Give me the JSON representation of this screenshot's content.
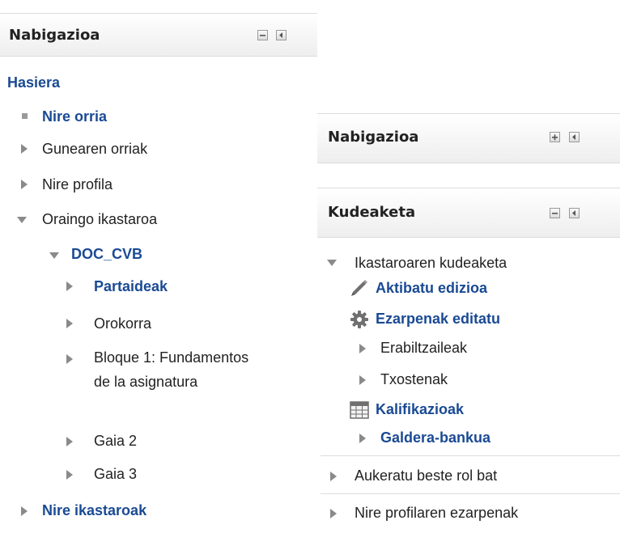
{
  "left_block": {
    "title": "Nabigazioa",
    "items": [
      {
        "label": "Hasiera"
      },
      {
        "label": "Nire orria"
      },
      {
        "label": "Gunearen orriak"
      },
      {
        "label": "Nire profila"
      },
      {
        "label": "Oraingo ikastaroa"
      },
      {
        "label": "DOC_CVB"
      },
      {
        "label": "Partaideak"
      },
      {
        "label": "Orokorra"
      },
      {
        "label": "Bloque 1: Fundamentos de la asignatura"
      },
      {
        "label": "Gaia 2"
      },
      {
        "label": "Gaia 3"
      },
      {
        "label": "Nire ikastaroak"
      }
    ]
  },
  "right_nav_block": {
    "title": "Nabigazioa"
  },
  "admin_block": {
    "title": "Kudeaketa",
    "items": [
      {
        "label": "Ikastaroaren kudeaketa"
      },
      {
        "label": "Aktibatu edizioa",
        "icon": "pencil-icon"
      },
      {
        "label": "Ezarpenak editatu",
        "icon": "gear-icon"
      },
      {
        "label": "Erabiltzaileak"
      },
      {
        "label": "Txostenak"
      },
      {
        "label": "Kalifikazioak",
        "icon": "table-icon"
      },
      {
        "label": "Galdera-bankua"
      },
      {
        "label": "Aukeratu beste rol bat"
      },
      {
        "label": "Nire profilaren ezarpenak"
      }
    ]
  },
  "colors": {
    "link": "#1a4a94",
    "text": "#222222",
    "tree_arrow": "#8a8a8a"
  }
}
